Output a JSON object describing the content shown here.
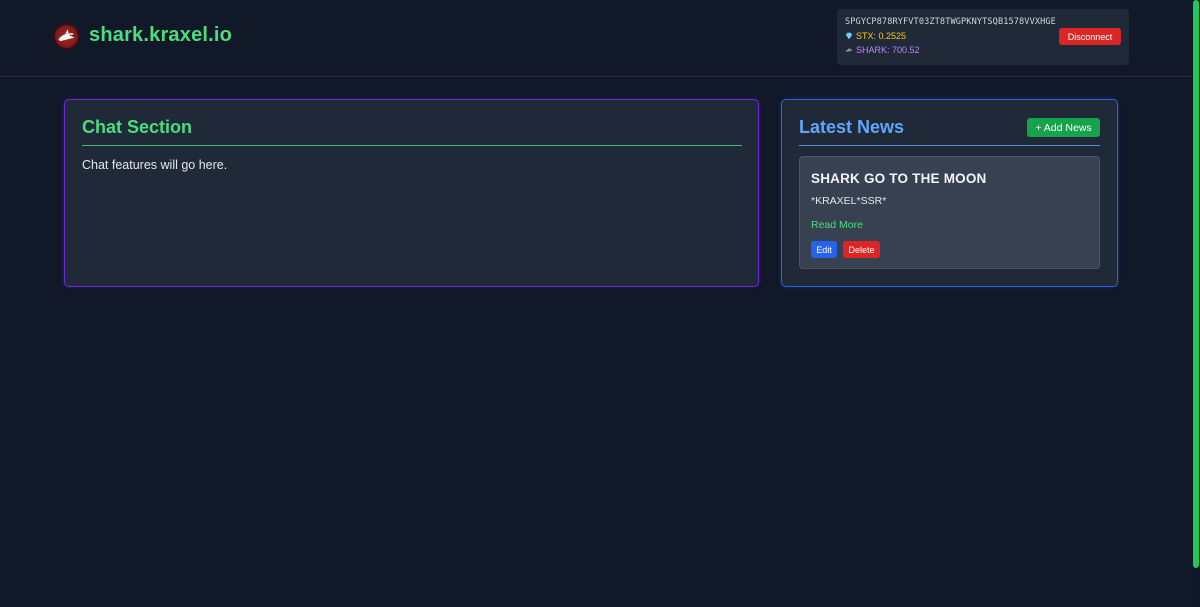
{
  "header": {
    "site_title": "shark.kraxel.io",
    "logo_icon": "shark-logo-icon"
  },
  "wallet": {
    "address": "SPGYCP878RYFVT03ZT8TWGPKNYTSQB1578VVXHGE",
    "stx_label": "STX: 0.2525",
    "stx_icon": "diamond-icon",
    "shark_label": "SHARK: 700.52",
    "shark_icon": "shark-icon",
    "disconnect_label": "Disconnect"
  },
  "chat": {
    "title": "Chat Section",
    "body": "Chat features will go here."
  },
  "news": {
    "title": "Latest News",
    "add_label": "+ Add News",
    "items": [
      {
        "title": "SHARK GO TO THE MOON",
        "body": "*KRAXEL*SSR*",
        "read_more": "Read More",
        "edit_label": "Edit",
        "delete_label": "Delete"
      }
    ]
  },
  "colors": {
    "background": "#111827",
    "panel": "#1f2937",
    "accent_green": "#4ade80",
    "accent_blue": "#60a5fa",
    "danger": "#dc2626",
    "stx_yellow": "#facc15",
    "shark_purple": "#c084fc"
  }
}
